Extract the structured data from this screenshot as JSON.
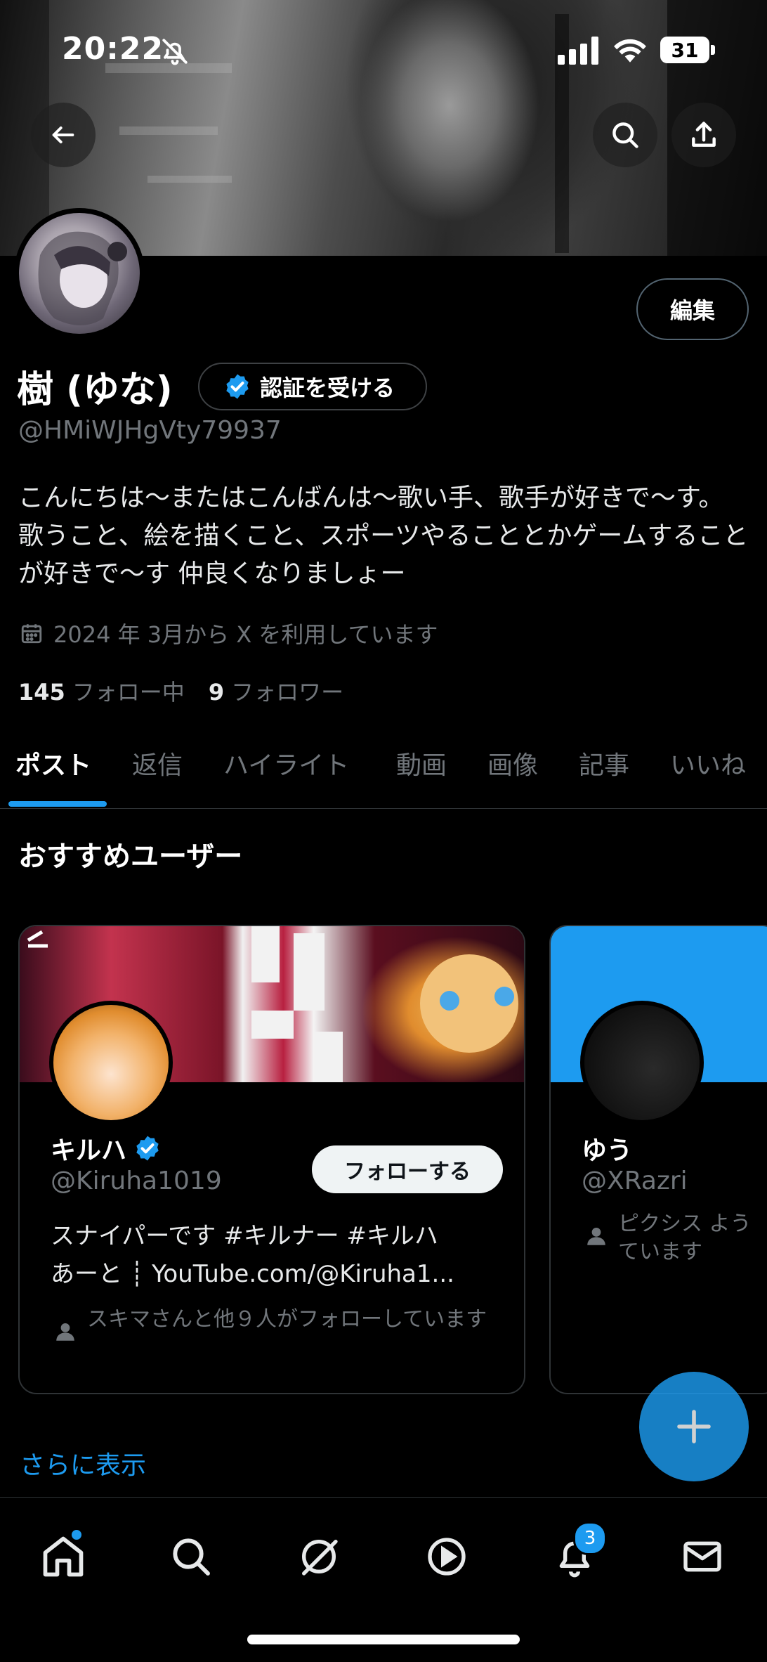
{
  "status_bar": {
    "time": "20:22",
    "battery": "31"
  },
  "profile": {
    "name": "樹 (ゆな)",
    "verify_label": "認証を受ける",
    "handle": "@HMiWJHgVty79937",
    "bio": "こんにちは〜またはこんばんは〜歌い手、歌手が好きで〜す。歌うこと、絵を描くこと、スポーツやることとかゲームすることが好きで〜す 仲良くなりましょー",
    "joined": "2024 年 3月から X を利用しています",
    "following_count": "145",
    "following_label": "フォロー中",
    "followers_count": "9",
    "followers_label": "フォロワー",
    "edit_label": "編集"
  },
  "tabs": [
    {
      "label": "ポスト",
      "active": true
    },
    {
      "label": "返信"
    },
    {
      "label": "ハイライト"
    },
    {
      "label": "動画"
    },
    {
      "label": "画像"
    },
    {
      "label": "記事"
    },
    {
      "label": "いいね"
    }
  ],
  "recommended": {
    "title": "おすすめユーザー",
    "show_more": "さらに表示",
    "cards": [
      {
        "name": "キルハ",
        "verified": true,
        "handle": "@Kiruha1019",
        "follow_label": "フォローする",
        "bio_line1": "スナイパーです #キルナー #キルハ",
        "bio_line2": "あーと ┊ YouTube.com/@Kiruha1...",
        "followed_by": "スキマさんと他９人がフォローしています"
      },
      {
        "name": "ゆう",
        "handle": "@XRazri",
        "followed_by": "ピクシス よう ています"
      }
    ]
  },
  "bottom_nav": {
    "notifications_badge": "3"
  },
  "colors": {
    "accent": "#1d9bf0",
    "background": "#000000",
    "muted": "#71767b"
  }
}
